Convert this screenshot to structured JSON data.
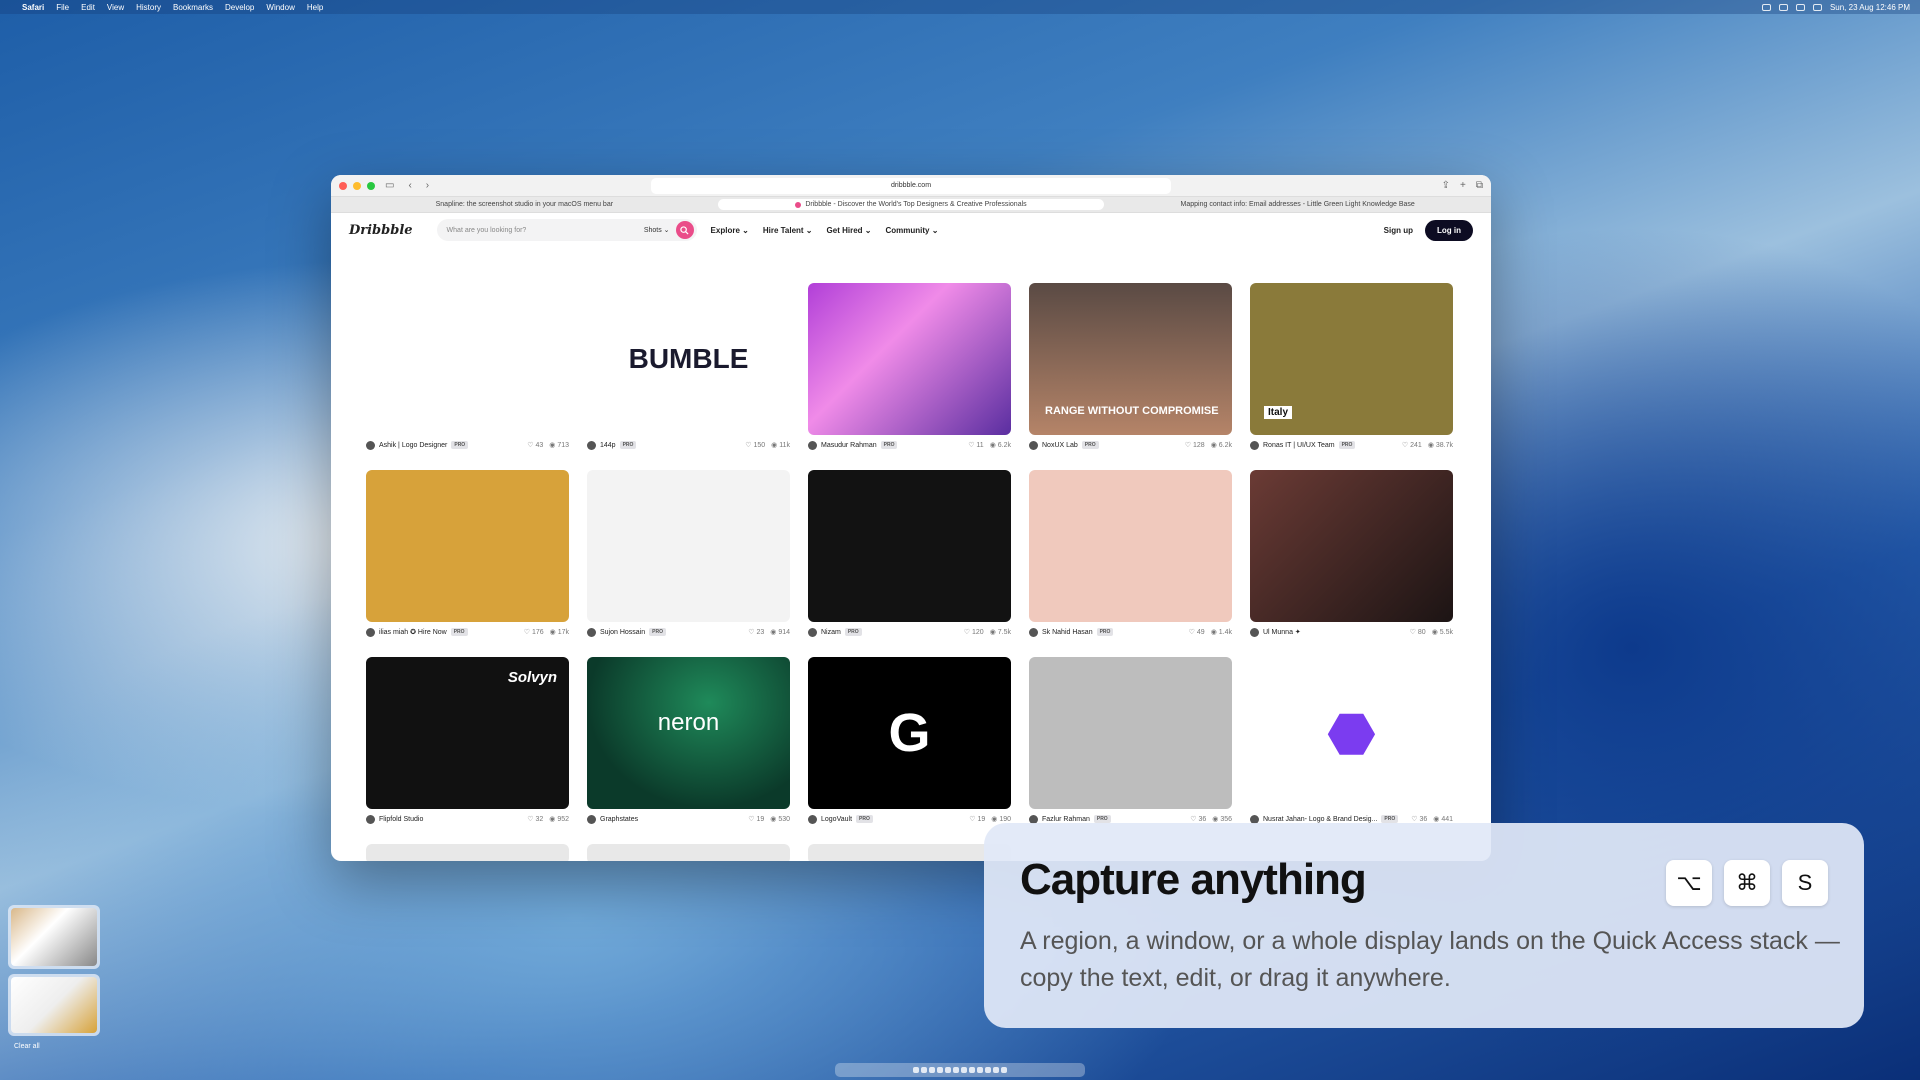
{
  "menubar": {
    "app": "Safari",
    "items": [
      "File",
      "Edit",
      "View",
      "History",
      "Bookmarks",
      "Develop",
      "Window",
      "Help"
    ],
    "clock": "Sun, 23 Aug 12:46 PM"
  },
  "browser": {
    "url": "dribbble.com",
    "tabs": [
      {
        "title": "Snapline: the screenshot studio in your macOS menu bar",
        "active": false
      },
      {
        "title": "Dribbble - Discover the World's Top Designers & Creative Professionals",
        "active": true
      },
      {
        "title": "Mapping contact info: Email addresses - Little Green Light Knowledge Base",
        "active": false
      }
    ]
  },
  "dribbble": {
    "logo": "Dribbble",
    "search_placeholder": "What are you looking for?",
    "search_filter": "Shots",
    "nav": [
      "Explore",
      "Hire Talent",
      "Get Hired",
      "Community"
    ],
    "signup": "Sign up",
    "login": "Log in"
  },
  "shots": [
    {
      "author": "Ashik | Logo Designer",
      "badge": "PRO",
      "likes": "43",
      "views": "713"
    },
    {
      "author": "144p",
      "badge": "PRO",
      "likes": "150",
      "views": "11k",
      "art_text": "BUMBLE"
    },
    {
      "author": "Masudur Rahman",
      "badge": "PRO",
      "likes": "11",
      "views": "6.2k"
    },
    {
      "author": "NoxUX Lab",
      "badge": "PRO",
      "likes": "128",
      "views": "6.2k",
      "art_text": "RANGE WITHOUT COMPROMISE"
    },
    {
      "author": "Ronas IT | UI/UX Team",
      "badge": "PRO",
      "likes": "241",
      "views": "38.7k",
      "art_text": "Italy"
    },
    {
      "author": "ilias miah ✪ Hire Now",
      "badge": "PRO",
      "likes": "176",
      "views": "17k"
    },
    {
      "author": "Sujon Hossain",
      "badge": "PRO",
      "likes": "23",
      "views": "914"
    },
    {
      "author": "Nizam",
      "badge": "PRO",
      "likes": "120",
      "views": "7.5k"
    },
    {
      "author": "Sk Nahid Hasan",
      "badge": "PRO",
      "likes": "49",
      "views": "1.4k"
    },
    {
      "author": "Ul Munna ✦",
      "badge": "",
      "likes": "80",
      "views": "5.5k"
    },
    {
      "author": "Flipfold Studio",
      "badge": "",
      "likes": "32",
      "views": "952",
      "art_text": "Solvyn"
    },
    {
      "author": "Graphstates",
      "badge": "",
      "likes": "19",
      "views": "530",
      "art_text": "neron"
    },
    {
      "author": "LogoVault",
      "badge": "PRO",
      "likes": "19",
      "views": "190"
    },
    {
      "author": "Fazlur Rahman",
      "badge": "PRO",
      "likes": "36",
      "views": "356"
    },
    {
      "author": "Nusrat Jahan- Logo & Brand Desig...",
      "badge": "PRO",
      "likes": "36",
      "views": "441"
    }
  ],
  "quick_access": {
    "clear_all": "Clear all"
  },
  "panel": {
    "title": "Capture anything",
    "keys": [
      "⌥",
      "⌘",
      "S"
    ],
    "description": "A region, a window, or a whole display lands on the Quick Access stack — copy the text, edit, or drag it anywhere."
  },
  "colors": {
    "accent": "#ea4c89",
    "dark": "#0d0c22"
  }
}
